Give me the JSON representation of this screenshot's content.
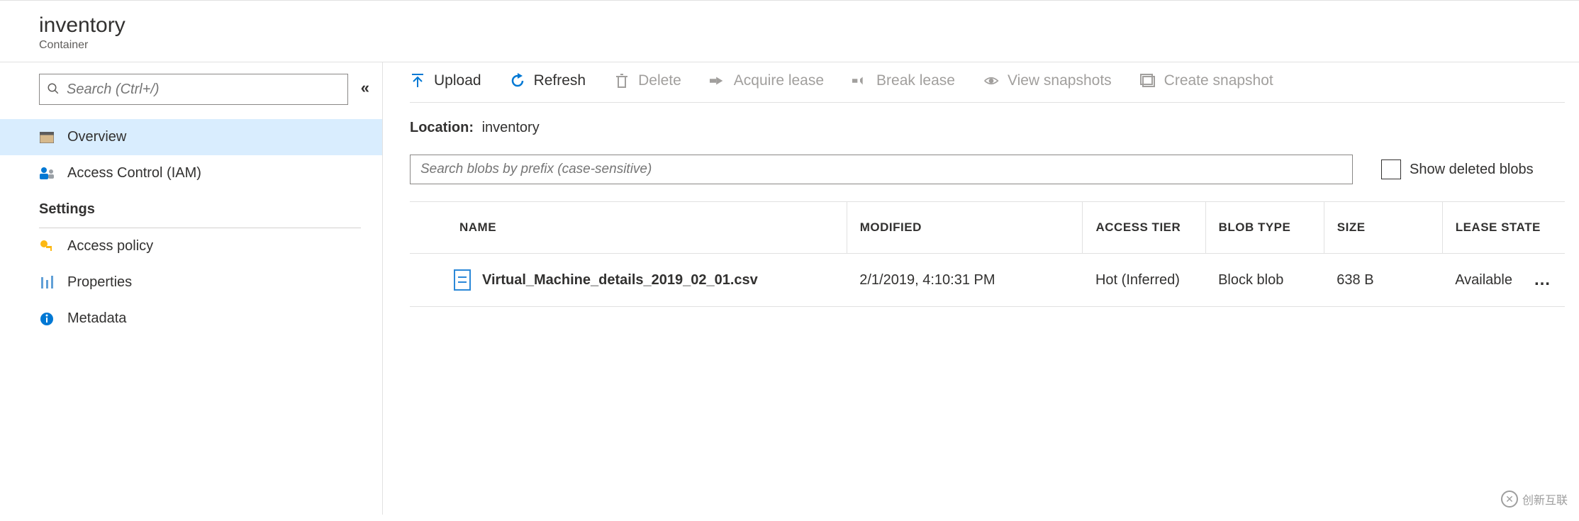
{
  "header": {
    "title": "inventory",
    "subtitle": "Container"
  },
  "sidebar": {
    "search_placeholder": "Search (Ctrl+/)",
    "nav_primary": [
      {
        "id": "overview",
        "label": "Overview",
        "active": true
      },
      {
        "id": "iam",
        "label": "Access Control (IAM)",
        "active": false
      }
    ],
    "group_label": "Settings",
    "nav_settings": [
      {
        "id": "access-policy",
        "label": "Access policy"
      },
      {
        "id": "properties",
        "label": "Properties"
      },
      {
        "id": "metadata",
        "label": "Metadata"
      }
    ]
  },
  "toolbar": {
    "upload": "Upload",
    "refresh": "Refresh",
    "delete": "Delete",
    "acquire_lease": "Acquire lease",
    "break_lease": "Break lease",
    "view_snapshots": "View snapshots",
    "create_snapshot": "Create snapshot"
  },
  "location": {
    "label": "Location:",
    "value": "inventory"
  },
  "filter": {
    "prefix_placeholder": "Search blobs by prefix (case-sensitive)",
    "show_deleted_label": "Show deleted blobs"
  },
  "table": {
    "headers": {
      "name": "NAME",
      "modified": "MODIFIED",
      "access_tier": "ACCESS TIER",
      "blob_type": "BLOB TYPE",
      "size": "SIZE",
      "lease_state": "LEASE STATE"
    },
    "rows": [
      {
        "name": "Virtual_Machine_details_2019_02_01.csv",
        "modified": "2/1/2019, 4:10:31 PM",
        "access_tier": "Hot (Inferred)",
        "blob_type": "Block blob",
        "size": "638 B",
        "lease_state": "Available"
      }
    ]
  },
  "watermark": "创新互联"
}
